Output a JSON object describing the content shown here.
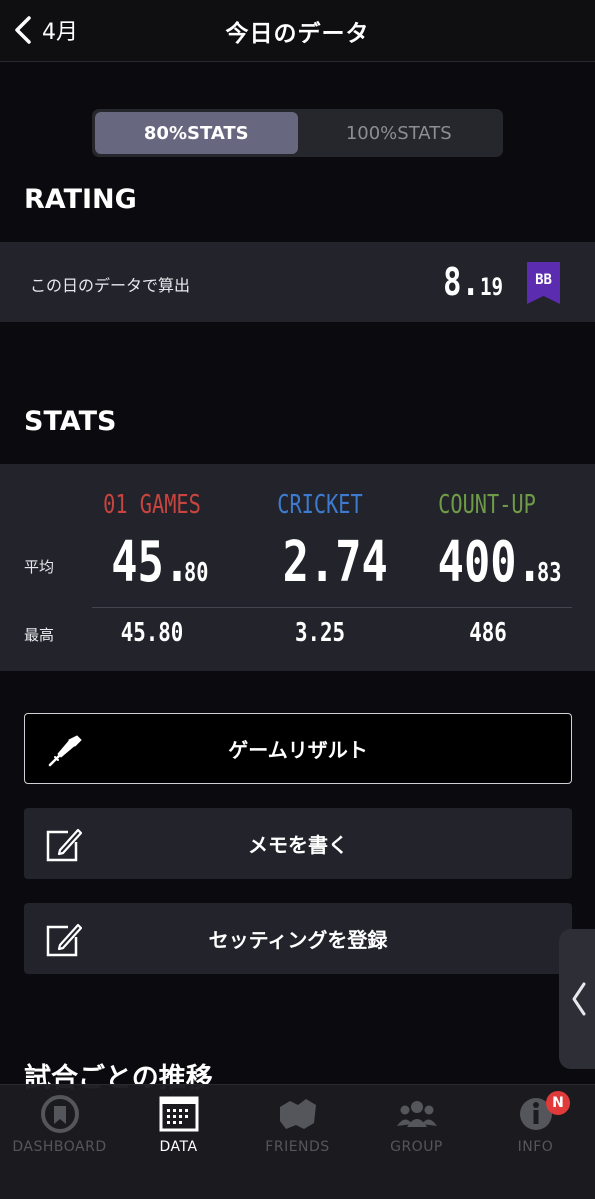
{
  "header": {
    "back_label": "4月",
    "title": "今日のデータ"
  },
  "toggle": {
    "options": [
      "80%STATS",
      "100%STATS"
    ],
    "selected": "80%STATS"
  },
  "rating": {
    "section_title": "RATING",
    "label": "この日のデータで算出",
    "value_int": "8.",
    "value_dec": "19",
    "badge": "BB",
    "badge_color": "#5b2bb0"
  },
  "stats": {
    "section_title": "STATS",
    "avg_label": "平均",
    "max_label": "最高",
    "columns": [
      {
        "name": "01 GAMES",
        "color": "#c8443f",
        "avg_int": "45.",
        "avg_dec": "80",
        "max": "45.80"
      },
      {
        "name": "CRICKET",
        "color": "#3d7bd1",
        "avg_int": "2.74",
        "avg_dec": "",
        "max": "3.25"
      },
      {
        "name": "COUNT-UP",
        "color": "#6e9c46",
        "avg_int": "400.",
        "avg_dec": "83",
        "max": "486"
      }
    ]
  },
  "actions": {
    "game_result": "ゲームリザルト",
    "write_memo": "メモを書く",
    "register_setting": "セッティングを登録"
  },
  "trend_title": "試合ごとの推移",
  "tabbar": {
    "items": [
      {
        "label": "DASHBOARD",
        "icon": "dashboard-icon"
      },
      {
        "label": "DATA",
        "icon": "calendar-icon"
      },
      {
        "label": "FRIENDS",
        "icon": "friends-icon"
      },
      {
        "label": "GROUP",
        "icon": "group-icon"
      },
      {
        "label": "INFO",
        "icon": "info-icon"
      }
    ],
    "active": "DATA",
    "info_badge": "N"
  }
}
